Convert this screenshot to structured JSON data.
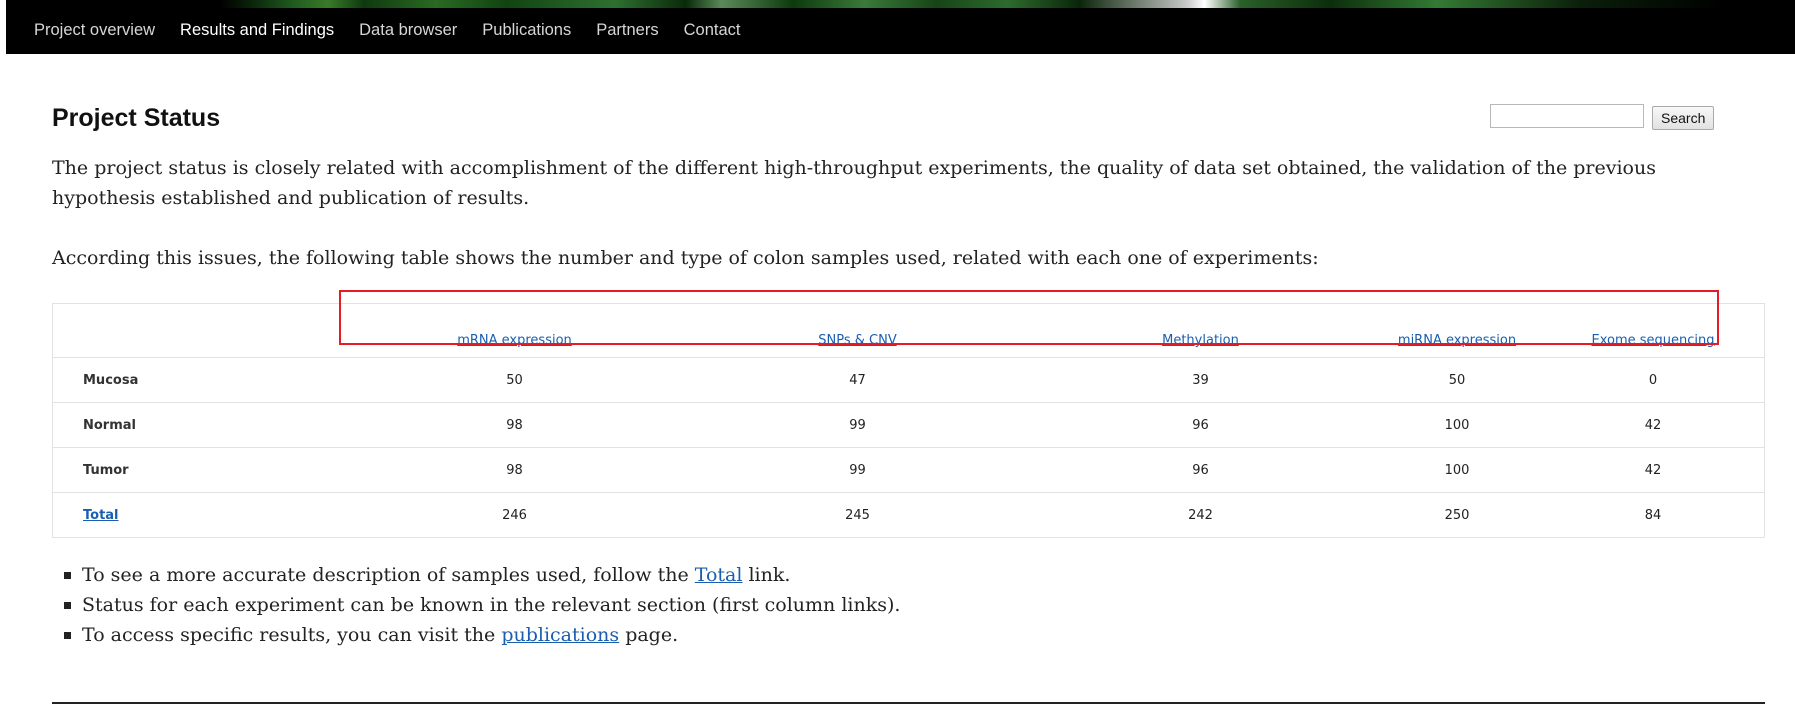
{
  "nav": {
    "items": [
      {
        "label": "Project overview",
        "active": false
      },
      {
        "label": "Results and Findings",
        "active": true
      },
      {
        "label": "Data browser",
        "active": false
      },
      {
        "label": "Publications",
        "active": false
      },
      {
        "label": "Partners",
        "active": false
      },
      {
        "label": "Contact",
        "active": false
      }
    ]
  },
  "page": {
    "title": "Project Status",
    "intro": "The project status is closely related with accomplishment of the different high-throughput experiments, the quality of data set obtained, the validation of the previous hypothesis established and publication of results.",
    "table_intro": "According this issues, the following table shows the number and type of colon samples used, related with each one of experiments:"
  },
  "search": {
    "placeholder": "",
    "button_label": "Search"
  },
  "table": {
    "columns": [
      "mRNA expression",
      "SNPs & CNV",
      "Methylation",
      "miRNA expression",
      "Exome sequencing"
    ],
    "rows": [
      {
        "label": "Mucosa",
        "values": [
          "50",
          "47",
          "39",
          "50",
          "0"
        ]
      },
      {
        "label": "Normal",
        "values": [
          "98",
          "99",
          "96",
          "100",
          "42"
        ]
      },
      {
        "label": "Tumor",
        "values": [
          "98",
          "99",
          "96",
          "100",
          "42"
        ]
      },
      {
        "label": "Total",
        "values": [
          "246",
          "245",
          "242",
          "250",
          "84"
        ]
      }
    ]
  },
  "notes": {
    "n1_before": "To see a more accurate description of samples used, follow the ",
    "n1_link": "Total",
    "n1_after": " link.",
    "n2": "Status for each experiment can be known in the relevant section (first column links).",
    "n3_before": "To access specific results, you can visit the ",
    "n3_link": "publications",
    "n3_after": " page."
  },
  "colors": {
    "link": "#1a5eb0",
    "highlight": "#e51c23",
    "nav_bg": "#000000"
  }
}
